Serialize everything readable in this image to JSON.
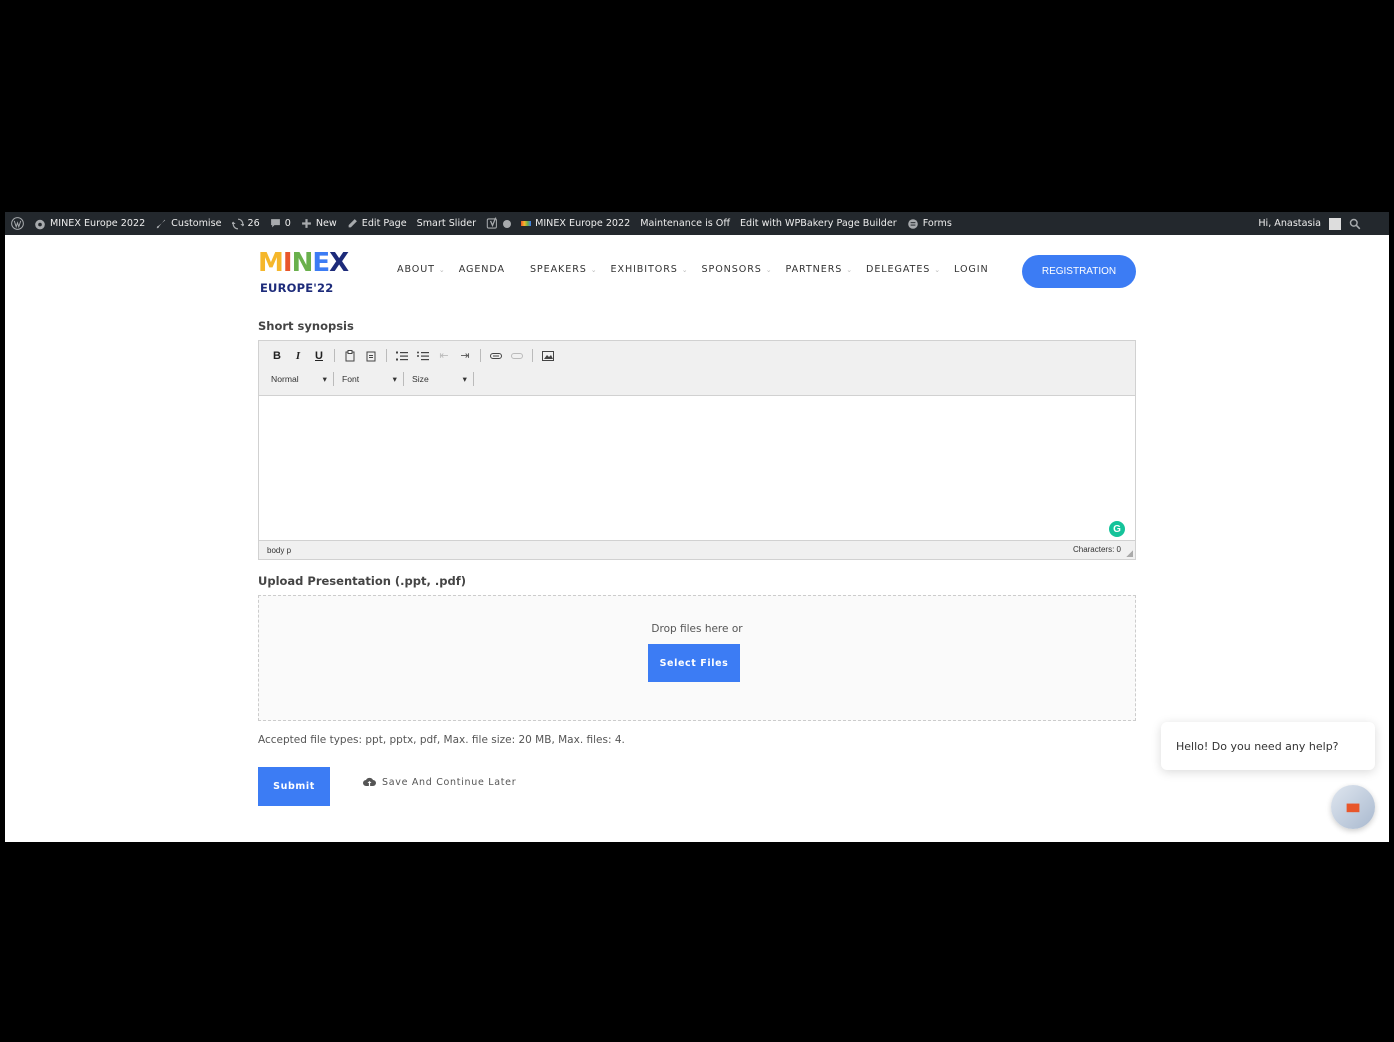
{
  "admin_bar": {
    "items": [
      {
        "icon": "wordpress-icon",
        "label": ""
      },
      {
        "icon": "dashboard-icon",
        "label": "MINEX Europe 2022"
      },
      {
        "icon": "brush-icon",
        "label": "Customise"
      },
      {
        "icon": "updates-icon",
        "label": "26"
      },
      {
        "icon": "comment-icon",
        "label": "0"
      },
      {
        "icon": "plus-icon",
        "label": "New"
      },
      {
        "icon": "pencil-icon",
        "label": "Edit Page"
      },
      {
        "icon": "",
        "label": "Smart Slider"
      },
      {
        "icon": "yoast-icon",
        "label": ""
      },
      {
        "icon": "status-dot-icon",
        "label": ""
      },
      {
        "icon": "minex-small-logo-icon",
        "label": "MINEX Europe 2022"
      },
      {
        "icon": "",
        "label": "Maintenance is Off"
      },
      {
        "icon": "",
        "label": "Edit with WPBakery Page Builder"
      },
      {
        "icon": "forms-icon",
        "label": "Forms"
      }
    ],
    "greeting": "Hi, Anastasia"
  },
  "site": {
    "logo_word": "MINEX",
    "logo_sub": "EUROPE'22",
    "nav": [
      {
        "label": "ABOUT",
        "dropdown": true
      },
      {
        "label": "AGENDA",
        "dropdown": false
      },
      {
        "label": "SPEAKERS",
        "dropdown": true
      },
      {
        "label": "EXHIBITORS",
        "dropdown": true
      },
      {
        "label": "SPONSORS",
        "dropdown": true
      },
      {
        "label": "PARTNERS",
        "dropdown": true
      },
      {
        "label": "DELEGATES",
        "dropdown": true
      },
      {
        "label": "LOGIN",
        "dropdown": false
      }
    ],
    "registration": "REGISTRATION"
  },
  "form": {
    "synopsis_label": "Short synopsis",
    "editor": {
      "format_select": "Normal",
      "font_select": "Font",
      "size_select": "Size",
      "status_path": "body  p",
      "characters": "Characters: 0"
    },
    "upload_label": "Upload Presentation (.ppt, .pdf)",
    "drop_text": "Drop files here or",
    "select_files": "Select Files",
    "accepted": "Accepted file types: ppt, pptx, pdf, Max. file size: 20 MB, Max. files: 4.",
    "submit": "Submit",
    "save_later": "Save And Continue Later"
  },
  "chat": {
    "message": "Hello! Do you need any help?"
  },
  "colors": {
    "accent": "#3c7cf4",
    "admin_bar": "#23282d",
    "grammarly": "#15c39a"
  }
}
